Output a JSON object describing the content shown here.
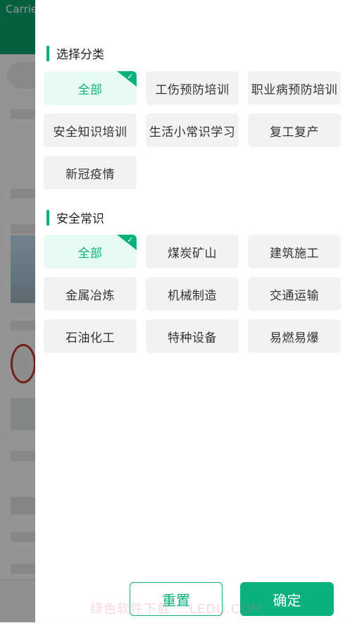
{
  "status_bar": {
    "carrier": "Carrie"
  },
  "filter_panel": {
    "category_section": {
      "title": "选择分类",
      "options": [
        {
          "label": "全部",
          "selected": true
        },
        {
          "label": "工伤预防培训",
          "selected": false
        },
        {
          "label": "职业病预防培训",
          "selected": false
        },
        {
          "label": "安全知识培训",
          "selected": false
        },
        {
          "label": "生活小常识学习",
          "selected": false
        },
        {
          "label": "复工复产",
          "selected": false
        },
        {
          "label": "新冠疫情",
          "selected": false
        }
      ]
    },
    "knowledge_section": {
      "title": "安全常识",
      "options": [
        {
          "label": "全部",
          "selected": true
        },
        {
          "label": "煤炭矿山",
          "selected": false
        },
        {
          "label": "建筑施工",
          "selected": false
        },
        {
          "label": "金属冶炼",
          "selected": false
        },
        {
          "label": "机械制造",
          "selected": false
        },
        {
          "label": "交通运输",
          "selected": false
        },
        {
          "label": "石油化工",
          "selected": false
        },
        {
          "label": "特种设备",
          "selected": false
        },
        {
          "label": "易燃易爆",
          "selected": false
        }
      ]
    },
    "buttons": {
      "reset_label": "重置",
      "confirm_label": "确定"
    },
    "watermark": "绿色软件下载 ...LEDU.COM"
  },
  "colors": {
    "accent": "#0bb17d",
    "selected_bg": "#e6faf4",
    "chip_bg": "#f2f2f2",
    "header_green": "#0aa56f"
  },
  "icons": {
    "selected_mark": "checkmark-icon"
  }
}
